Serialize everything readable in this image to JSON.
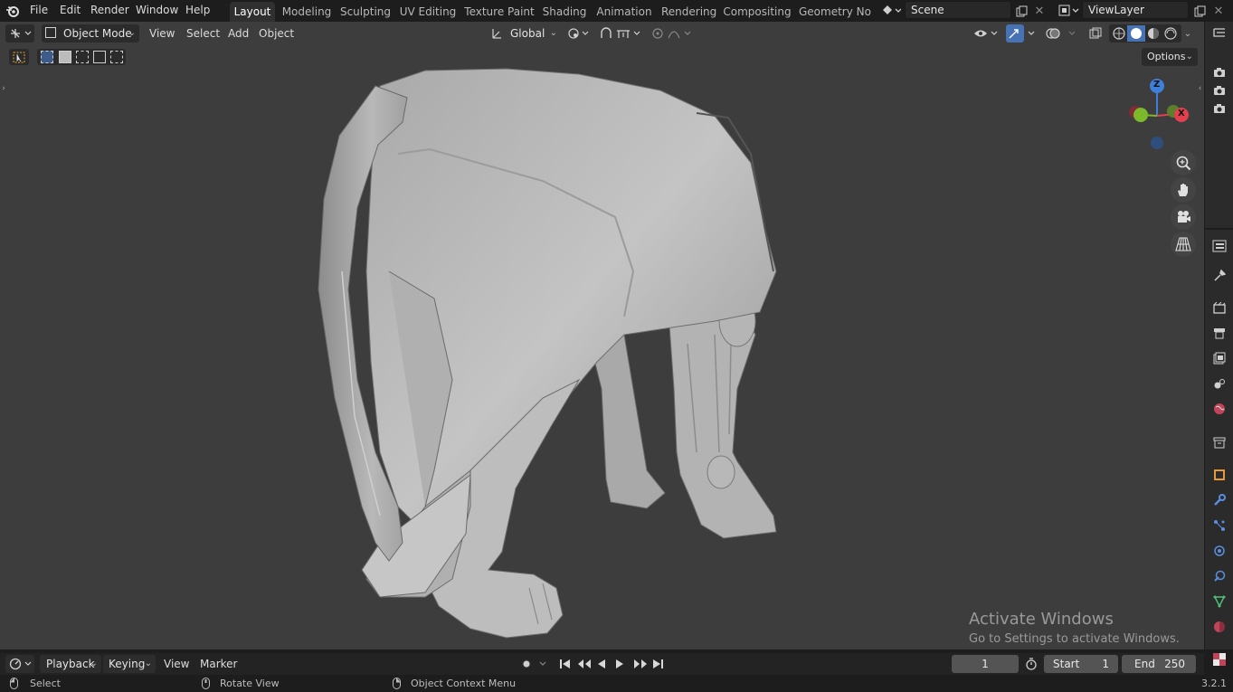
{
  "menu": {
    "items": [
      "File",
      "Edit",
      "Render",
      "Window",
      "Help"
    ]
  },
  "workspaces": {
    "tabs": [
      "Layout",
      "Modeling",
      "Sculpting",
      "UV Editing",
      "Texture Paint",
      "Shading",
      "Animation",
      "Rendering",
      "Compositing",
      "Geometry Noc"
    ],
    "active": "Layout"
  },
  "scene": {
    "name": "Scene"
  },
  "view_layer": {
    "name": "ViewLayer"
  },
  "viewport_header": {
    "mode": "Object Mode",
    "menus": [
      "View",
      "Select",
      "Add",
      "Object"
    ],
    "orientation": "Global",
    "options_label": "Options"
  },
  "gizmo": {
    "z": "Z",
    "x": "X"
  },
  "timeline": {
    "playback": "Playback",
    "keying": "Keying",
    "view": "View",
    "marker": "Marker",
    "current_frame": "1",
    "start_label": "Start",
    "start_value": "1",
    "end_label": "End",
    "end_value": "250"
  },
  "statusbar": {
    "select": "Select",
    "rotate": "Rotate View",
    "context": "Object Context Menu",
    "version": "3.2.1"
  },
  "watermark": {
    "line1": "Activate Windows",
    "line2": "Go to Settings to activate Windows."
  },
  "colors": {
    "accent": "#4772b3",
    "axis_x": "#e2404f",
    "axis_y": "#7cba2b",
    "axis_z": "#3d7fd9",
    "viewport_bg": "#3d3d3d"
  }
}
